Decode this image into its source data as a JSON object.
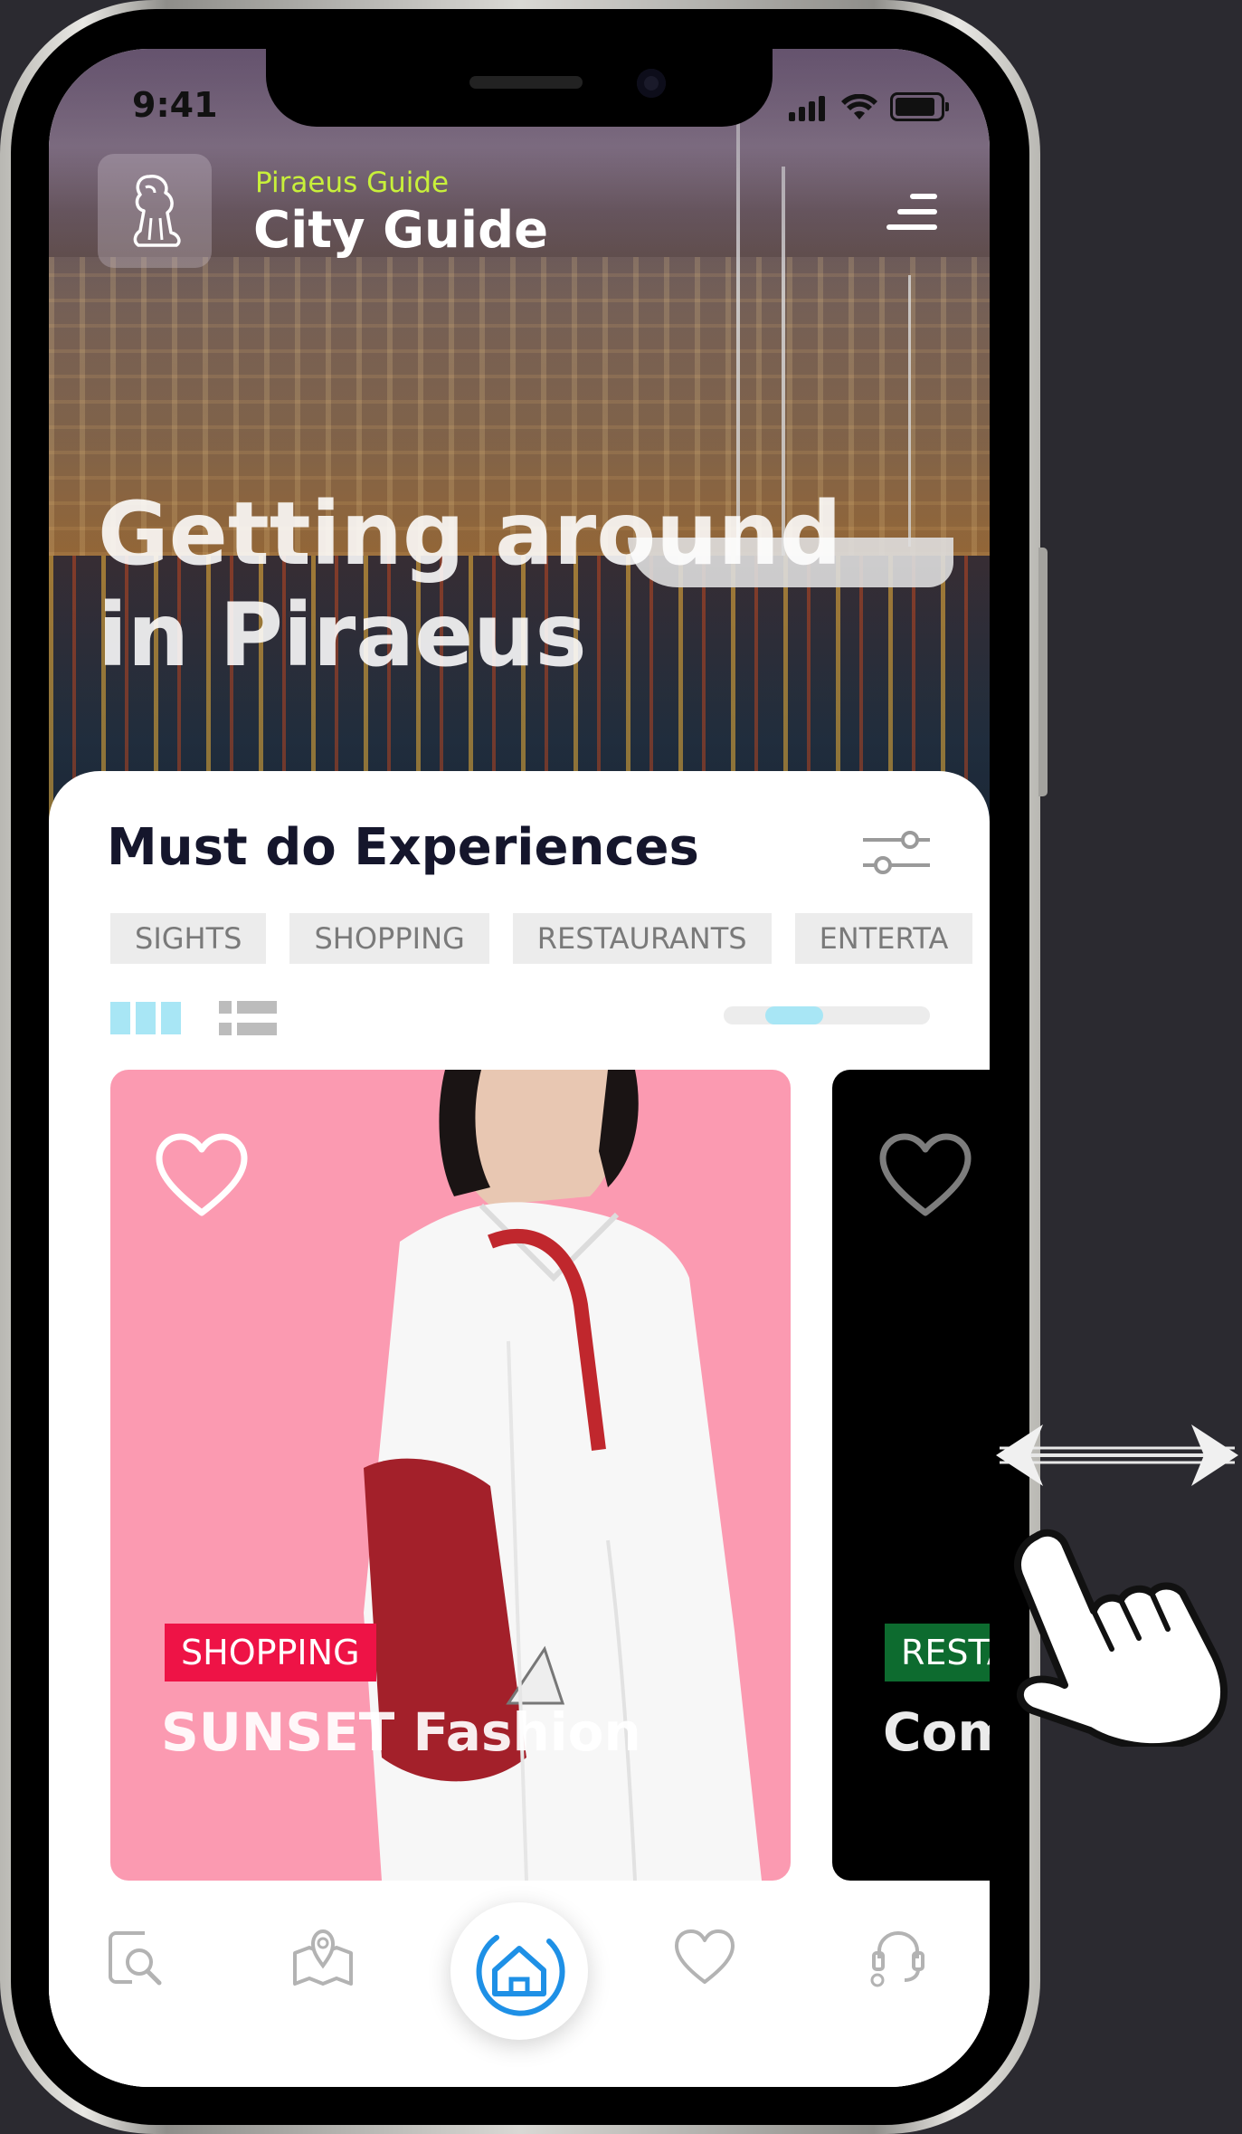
{
  "status_bar": {
    "time": "9:41"
  },
  "header": {
    "brand_subtitle": "Piraeus Guide",
    "brand_title": "City Guide",
    "logo_icon": "lion-icon",
    "menu_icon": "hamburger-menu-icon"
  },
  "hero": {
    "title_line1": "Getting around",
    "title_line2": "in Piraeus"
  },
  "experiences": {
    "section_title": "Must do Experiences",
    "filter_icon": "sliders-icon",
    "categories": [
      "SIGHTS",
      "SHOPPING",
      "RESTAURANTS",
      "ENTERTA"
    ],
    "view_modes": [
      "grid-view-icon",
      "list-view-icon"
    ],
    "scroll_progress": 0.2,
    "cards": [
      {
        "category": "SHOPPING",
        "category_color": "#ee1346",
        "title": "SUNSET Fashion",
        "background": "#fb9ab1"
      },
      {
        "category": "RESTA",
        "category_color": "#0d6b2f",
        "title": "Com",
        "background": "#000000"
      }
    ]
  },
  "tabbar": {
    "items": [
      "search-icon",
      "map-icon",
      "home-icon",
      "heart-icon",
      "support-icon"
    ],
    "active": "home-icon",
    "accent_color": "#1e90e6"
  }
}
